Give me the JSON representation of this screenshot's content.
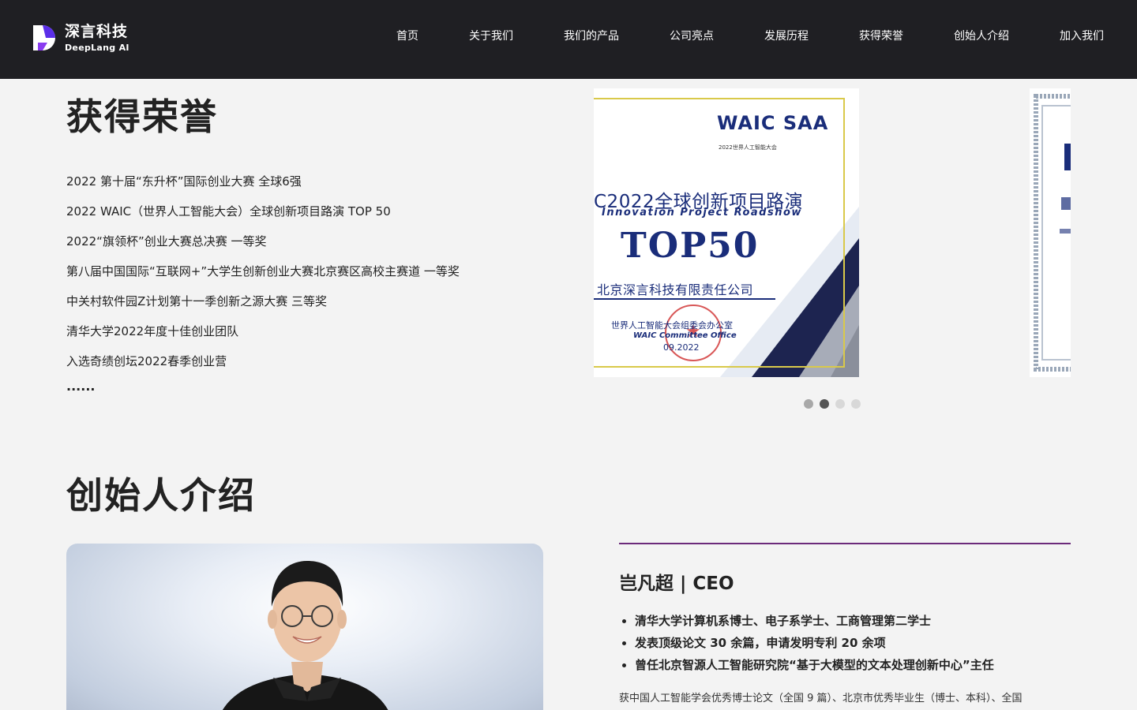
{
  "brand": {
    "name_cn": "深言科技",
    "name_en": "DeepLang AI",
    "primary_color": "#5b2ee8",
    "accent_color": "#8a3cf0"
  },
  "nav": {
    "items": [
      {
        "label": "首页"
      },
      {
        "label": "关于我们"
      },
      {
        "label": "我们的产品"
      },
      {
        "label": "公司亮点"
      },
      {
        "label": "发展历程"
      },
      {
        "label": "获得荣誉"
      },
      {
        "label": "创始人介绍"
      },
      {
        "label": "加入我们"
      }
    ]
  },
  "honors": {
    "title": "获得荣誉",
    "items": [
      "2022 第十届“东升杯”国际创业大赛 全球6强",
      "2022 WAIC（世界人工智能大会）全球创新项目路演 TOP 50",
      "2022“旗领杯”创业大赛总决赛 一等奖",
      "第八届中国国际“互联网+”大学生创新创业大赛北京赛区高校主赛道 一等奖",
      "中关村软件园Z计划第十一季创新之源大赛 三等奖",
      "清华大学2022年度十佳创业团队",
      "入选奇绩创坛2022春季创业营"
    ],
    "more": "......"
  },
  "certificate": {
    "logo_text": "WAIC SAA",
    "logo_sub": "2022世界人工智能大会",
    "title": "C2022全球创新项目路演",
    "title_en": "Innovation Project Roadshow",
    "rank": "TOP50",
    "company": "北京深言科技有限责任公司",
    "office_cn": "世界人工智能大会组委会办公室",
    "office_en": "WAIC Committee Office",
    "date": "09.2022"
  },
  "carousel": {
    "slide_count": 4,
    "active_index": 1,
    "active_color": "#555555",
    "inactive_color": "#d8d8d8",
    "visited_color": "#a8a8a8"
  },
  "founder": {
    "section_title": "创始人介绍",
    "name": "岂凡超 | CEO",
    "bullets": [
      "清华大学计算机系博士、电子系学士、工商管理第二学士",
      "发表顶级论文 30 余篇，申请发明专利 20 余项",
      "曾任北京智源人工智能研究院“基于大模型的文本处理创新中心”主任"
    ],
    "description": "获中国人工智能学会优秀博士论文（全国 9 篇）、北京市优秀毕业生（博士、本科）、全国"
  }
}
